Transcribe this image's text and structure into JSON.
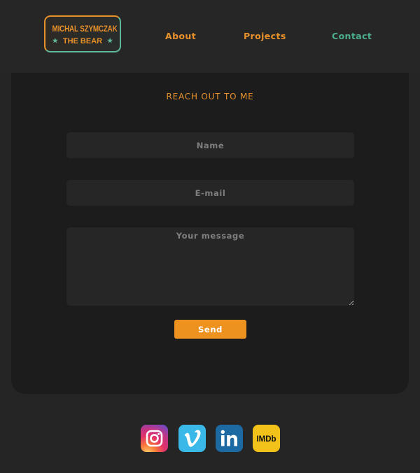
{
  "header": {
    "logo": {
      "line1": "MICHAL SZYMCZAK",
      "line2": "THE BEAR",
      "star": "★"
    },
    "nav": [
      {
        "label": "About"
      },
      {
        "label": "Projects"
      },
      {
        "label": "Contact"
      }
    ]
  },
  "contact_form": {
    "title": "REACH OUT TO ME",
    "name_placeholder": "Name",
    "email_placeholder": "E-mail",
    "message_placeholder": "Your message",
    "send_label": "Send"
  },
  "social": [
    {
      "icon": "instagram-icon"
    },
    {
      "icon": "vimeo-icon"
    },
    {
      "icon": "linkedin-icon"
    },
    {
      "icon": "imdb-icon",
      "text": "IMDb"
    }
  ],
  "colors": {
    "accent_orange": "#e8912a",
    "accent_green": "#4caf8c",
    "panel_bg": "#1c1c1c",
    "page_bg": "#252525",
    "button_bg": "#ee921f"
  }
}
